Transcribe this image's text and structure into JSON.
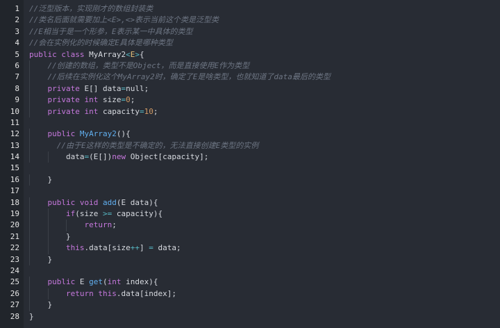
{
  "editor": {
    "lines": [
      {
        "n": "1",
        "indent": "",
        "tokens": [
          {
            "t": "//泛型版本，实现刚才的数组封装类",
            "k": "comment"
          }
        ]
      },
      {
        "n": "2",
        "indent": "",
        "tokens": [
          {
            "t": "//类名后面就需要加上<E>,<>表示当前这个类是泛型类",
            "k": "comment"
          }
        ]
      },
      {
        "n": "3",
        "indent": "",
        "tokens": [
          {
            "t": "//E相当于是一个形参，E表示某一中具体的类型",
            "k": "comment"
          }
        ]
      },
      {
        "n": "4",
        "indent": "",
        "tokens": [
          {
            "t": "//会在实例化的时候确定E具体是哪种类型",
            "k": "comment"
          }
        ]
      },
      {
        "n": "5",
        "indent": "",
        "tokens": [
          {
            "t": "public ",
            "k": "keyword"
          },
          {
            "t": "class ",
            "k": "keyword"
          },
          {
            "t": "MyArray2",
            "k": "plain"
          },
          {
            "t": "<",
            "k": "operator"
          },
          {
            "t": "E",
            "k": "type"
          },
          {
            "t": ">",
            "k": "operator"
          },
          {
            "t": "{",
            "k": "plain"
          }
        ]
      },
      {
        "n": "6",
        "indent": "    ",
        "tokens": [
          {
            "t": "//创建的数组，类型不是Object，而是直接使用E作为类型",
            "k": "comment"
          }
        ]
      },
      {
        "n": "7",
        "indent": "    ",
        "tokens": [
          {
            "t": "//后续在实例化这个MyArray2时，确定了E是啥类型，也就知道了data最后的类型",
            "k": "comment"
          }
        ]
      },
      {
        "n": "8",
        "indent": "    ",
        "tokens": [
          {
            "t": "private ",
            "k": "keyword"
          },
          {
            "t": "E[] data",
            "k": "plain"
          },
          {
            "t": "=",
            "k": "operator"
          },
          {
            "t": "null",
            "k": "plain"
          },
          {
            "t": ";",
            "k": "plain"
          }
        ]
      },
      {
        "n": "9",
        "indent": "    ",
        "tokens": [
          {
            "t": "private ",
            "k": "keyword"
          },
          {
            "t": "int ",
            "k": "keyword"
          },
          {
            "t": "size",
            "k": "plain"
          },
          {
            "t": "=",
            "k": "operator"
          },
          {
            "t": "0",
            "k": "number"
          },
          {
            "t": ";",
            "k": "plain"
          }
        ]
      },
      {
        "n": "10",
        "indent": "    ",
        "tokens": [
          {
            "t": "private ",
            "k": "keyword"
          },
          {
            "t": "int ",
            "k": "keyword"
          },
          {
            "t": "capacity",
            "k": "plain"
          },
          {
            "t": "=",
            "k": "operator"
          },
          {
            "t": "10",
            "k": "number"
          },
          {
            "t": ";",
            "k": "plain"
          }
        ]
      },
      {
        "n": "11",
        "indent": "",
        "tokens": []
      },
      {
        "n": "12",
        "indent": "    ",
        "tokens": [
          {
            "t": "public ",
            "k": "keyword"
          },
          {
            "t": "MyArray2",
            "k": "function"
          },
          {
            "t": "(){",
            "k": "plain"
          }
        ]
      },
      {
        "n": "13",
        "indent": "      ",
        "tokens": [
          {
            "t": "//由于E这样的类型是不确定的，无法直接创建E类型的实例",
            "k": "comment"
          }
        ]
      },
      {
        "n": "14",
        "indent": "        ",
        "tokens": [
          {
            "t": "data",
            "k": "plain"
          },
          {
            "t": "=",
            "k": "operator"
          },
          {
            "t": "(E[])",
            "k": "plain"
          },
          {
            "t": "new ",
            "k": "keyword"
          },
          {
            "t": "Object[capacity];",
            "k": "plain"
          }
        ]
      },
      {
        "n": "15",
        "indent": "",
        "tokens": []
      },
      {
        "n": "16",
        "indent": "    ",
        "tokens": [
          {
            "t": "}",
            "k": "plain"
          }
        ]
      },
      {
        "n": "17",
        "indent": "",
        "tokens": []
      },
      {
        "n": "18",
        "indent": "    ",
        "tokens": [
          {
            "t": "public ",
            "k": "keyword"
          },
          {
            "t": "void ",
            "k": "keyword"
          },
          {
            "t": "add",
            "k": "function"
          },
          {
            "t": "(E data){",
            "k": "plain"
          }
        ]
      },
      {
        "n": "19",
        "indent": "        ",
        "tokens": [
          {
            "t": "if",
            "k": "keyword"
          },
          {
            "t": "(size ",
            "k": "plain"
          },
          {
            "t": ">=",
            "k": "operator"
          },
          {
            "t": " capacity){",
            "k": "plain"
          }
        ]
      },
      {
        "n": "20",
        "indent": "            ",
        "tokens": [
          {
            "t": "return",
            "k": "keyword"
          },
          {
            "t": ";",
            "k": "plain"
          }
        ]
      },
      {
        "n": "21",
        "indent": "        ",
        "tokens": [
          {
            "t": "}",
            "k": "plain"
          }
        ]
      },
      {
        "n": "22",
        "indent": "        ",
        "tokens": [
          {
            "t": "this",
            "k": "keyword"
          },
          {
            "t": ".data[size",
            "k": "plain"
          },
          {
            "t": "++",
            "k": "operator"
          },
          {
            "t": "] ",
            "k": "plain"
          },
          {
            "t": "=",
            "k": "operator"
          },
          {
            "t": " data;",
            "k": "plain"
          }
        ]
      },
      {
        "n": "23",
        "indent": "    ",
        "tokens": [
          {
            "t": "}",
            "k": "plain"
          }
        ]
      },
      {
        "n": "24",
        "indent": "",
        "tokens": []
      },
      {
        "n": "25",
        "indent": "    ",
        "tokens": [
          {
            "t": "public ",
            "k": "keyword"
          },
          {
            "t": "E ",
            "k": "plain"
          },
          {
            "t": "get",
            "k": "function"
          },
          {
            "t": "(",
            "k": "plain"
          },
          {
            "t": "int ",
            "k": "keyword"
          },
          {
            "t": "index){",
            "k": "plain"
          }
        ]
      },
      {
        "n": "26",
        "indent": "        ",
        "tokens": [
          {
            "t": "return ",
            "k": "keyword"
          },
          {
            "t": "this",
            "k": "keyword"
          },
          {
            "t": ".data[index];",
            "k": "plain"
          }
        ]
      },
      {
        "n": "27",
        "indent": "    ",
        "tokens": [
          {
            "t": "}",
            "k": "plain"
          }
        ]
      },
      {
        "n": "28",
        "indent": "",
        "tokens": [
          {
            "t": "}",
            "k": "plain"
          }
        ]
      }
    ]
  },
  "colors": {
    "background": "#282c34",
    "gutter": "#21252b",
    "comment": "#6d7583",
    "keyword": "#c678dd",
    "function": "#61afef",
    "number": "#d19a66",
    "operator": "#56b6c2",
    "plain": "#d7dae0"
  }
}
